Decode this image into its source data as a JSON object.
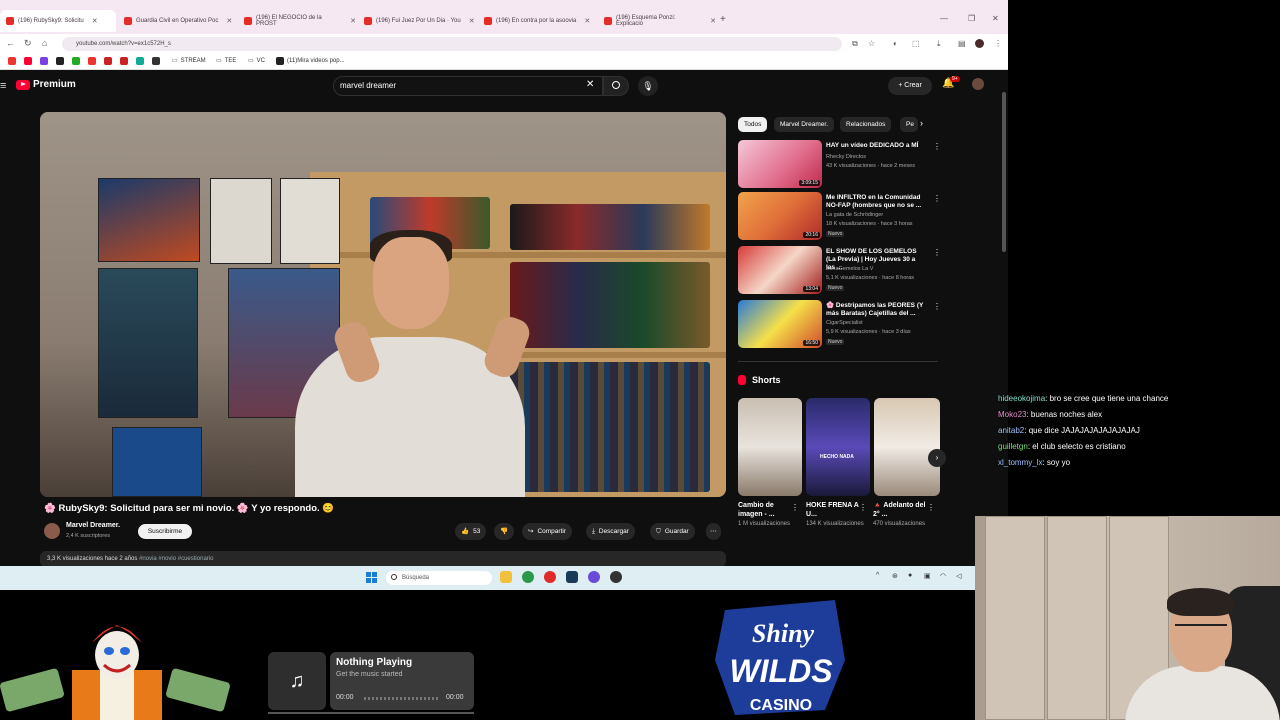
{
  "browser": {
    "tabs": [
      {
        "label": "(196) RubySky9: Solicitu"
      },
      {
        "label": "Guardia Civil en Operativo Poc"
      },
      {
        "label": "(196) El NEGOCIO de la PROST"
      },
      {
        "label": "(196) Fui Juez Por Un Dia · You"
      },
      {
        "label": "(196) En contra por la asoovia"
      },
      {
        "label": "(196) Esquema Ponzi: Explicacio"
      }
    ],
    "url": "youtube.com/watch?v=ex1c572H_s",
    "bookmarks": [
      {
        "label": "STREAM"
      },
      {
        "label": "TEE"
      },
      {
        "label": "VC"
      },
      {
        "label": "(11)Mira videos pop..."
      }
    ]
  },
  "youtube": {
    "logo_text": "Premium",
    "search_query": "marvel dreamer",
    "create_label": "Crear",
    "notif_count": "9+",
    "video": {
      "title": "🌸 RubySky9: Solicitud para ser mi novio. 🌸 Y yo respondo. 😊",
      "channel": "Marvel Dreamer.",
      "subscribers": "2,4 K suscriptores",
      "subscribe_label": "Suscribirme",
      "likes": "53",
      "share_label": "Compartir",
      "download_label": "Descargar",
      "save_label": "Guardar",
      "views_date": "3,3 K visualizaciones  hace 2 años",
      "tags": "#novia #novio #cuestionario"
    },
    "chips": [
      {
        "label": "Todos"
      },
      {
        "label": "Marvel Dreamer."
      },
      {
        "label": "Relacionados"
      },
      {
        "label": "Pe"
      }
    ],
    "recommendations": [
      {
        "title": "HAY un vídeo DEDICADO a MÍ",
        "channel": "Rhecky Directos",
        "meta": "43 K visualizaciones · hace 2 meses",
        "duration": "3:09:15",
        "badge": ""
      },
      {
        "title": "Me INFILTRO en la Comunidad NO-FAP (hombres que no se ...",
        "channel": "La gata de Schrödinger",
        "meta": "18 K visualizaciones · hace 3 horas",
        "duration": "20:16",
        "badge": "Nuevo"
      },
      {
        "title": "EL SHOW DE LOS GEMELOS (La Previa) | Hoy Jueves 30 a las ...",
        "channel": "ZonaGemelos La V",
        "meta": "5,1 K visualizaciones · hace 8 horas",
        "duration": "13:04",
        "badge": "Nuevo"
      },
      {
        "title": "🌸 Destripamos las PEORES (Y más Baratas) Cajetillas del ...",
        "channel": "CigarSpecialist",
        "meta": "5,9 K visualizaciones · hace 3 días",
        "duration": "16:50",
        "badge": "Nuevo"
      }
    ],
    "shorts_heading": "Shorts",
    "shorts": [
      {
        "title": "Cambio de imagen - ...",
        "views": "1 M visualizaciones"
      },
      {
        "title": "HOKE FRENA A U...",
        "views": "134 K visualizaciones"
      },
      {
        "title": "🔺 Adelanto del 2° ...",
        "views": "470 visualizaciones"
      }
    ],
    "short_overlay": "HECHO NADA"
  },
  "taskbar": {
    "search_placeholder": "Búsqueda"
  },
  "chat": [
    {
      "user": "hideeokojima",
      "text": ": bro se cree que tiene una chance",
      "color": "#7fe0d0"
    },
    {
      "user": "Moko23",
      "text": ": buenas noches alex",
      "color": "#e88fd0"
    },
    {
      "user": "anitab2",
      "text": ": que dice JAJAJAJAJAJAJAJAJ",
      "color": "#9fc2ff"
    },
    {
      "user": "guilletgn",
      "text": ": el club selecto es cristiano",
      "color": "#7fe07f"
    },
    {
      "user": "xl_tommy_lx",
      "text": ": soy yo",
      "color": "#9fc2ff"
    }
  ],
  "player": {
    "title": "Nothing Playing",
    "subtitle": "Get the music started",
    "time_start": "00:00",
    "time_end": "00:00"
  },
  "casino": {
    "line1": "Shiny",
    "line2": "WILDS",
    "line3": "CASINO"
  },
  "colors": {
    "yt_bg": "#0f0f0f",
    "yt_red": "#ff0033",
    "chrome_tab_bg": "#f6e8f3"
  }
}
